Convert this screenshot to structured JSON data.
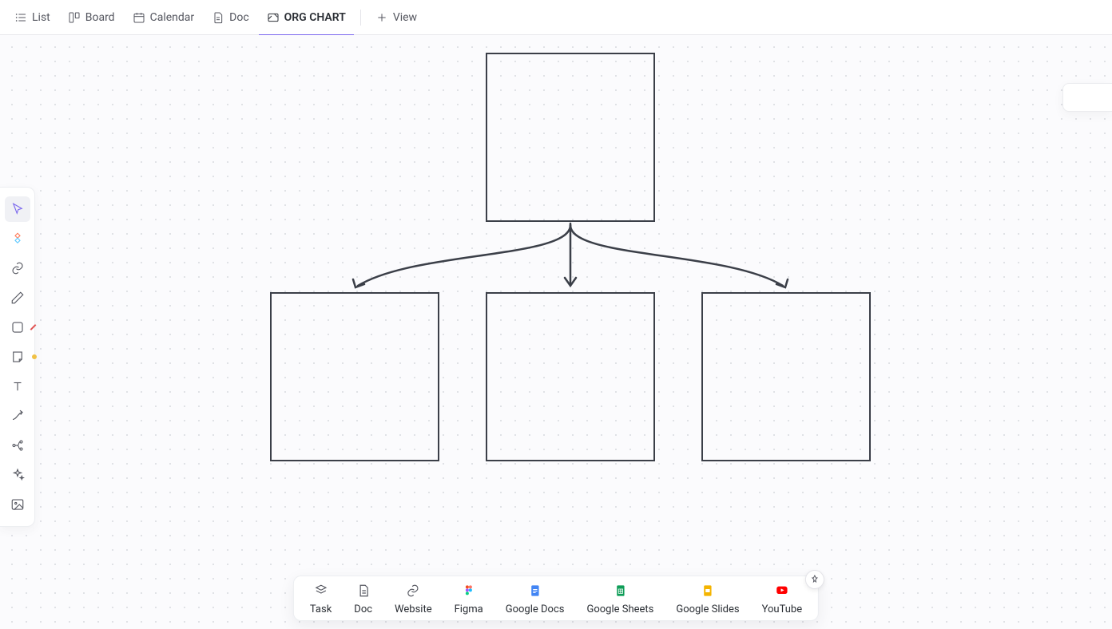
{
  "tabs": {
    "list": "List",
    "board": "Board",
    "calendar": "Calendar",
    "doc": "Doc",
    "org_chart": "ORG CHART",
    "add_view": "View"
  },
  "tools": {
    "pointer_indicator": "#7b68ee",
    "pen_indicator": "#6b5ce7",
    "shape_indicator": "#e05252",
    "sticky_indicator": "#f0c145"
  },
  "dock": {
    "task": "Task",
    "doc": "Doc",
    "website": "Website",
    "figma": "Figma",
    "google_docs": "Google Docs",
    "google_sheets": "Google Sheets",
    "google_slides": "Google Slides",
    "youtube": "YouTube"
  },
  "colors": {
    "accent": "#7b68ee",
    "box_border": "#3b3f48",
    "google_blue": "#4285f4",
    "google_green": "#0f9d58",
    "google_yellow": "#f4b400",
    "youtube_red": "#ff0000"
  }
}
